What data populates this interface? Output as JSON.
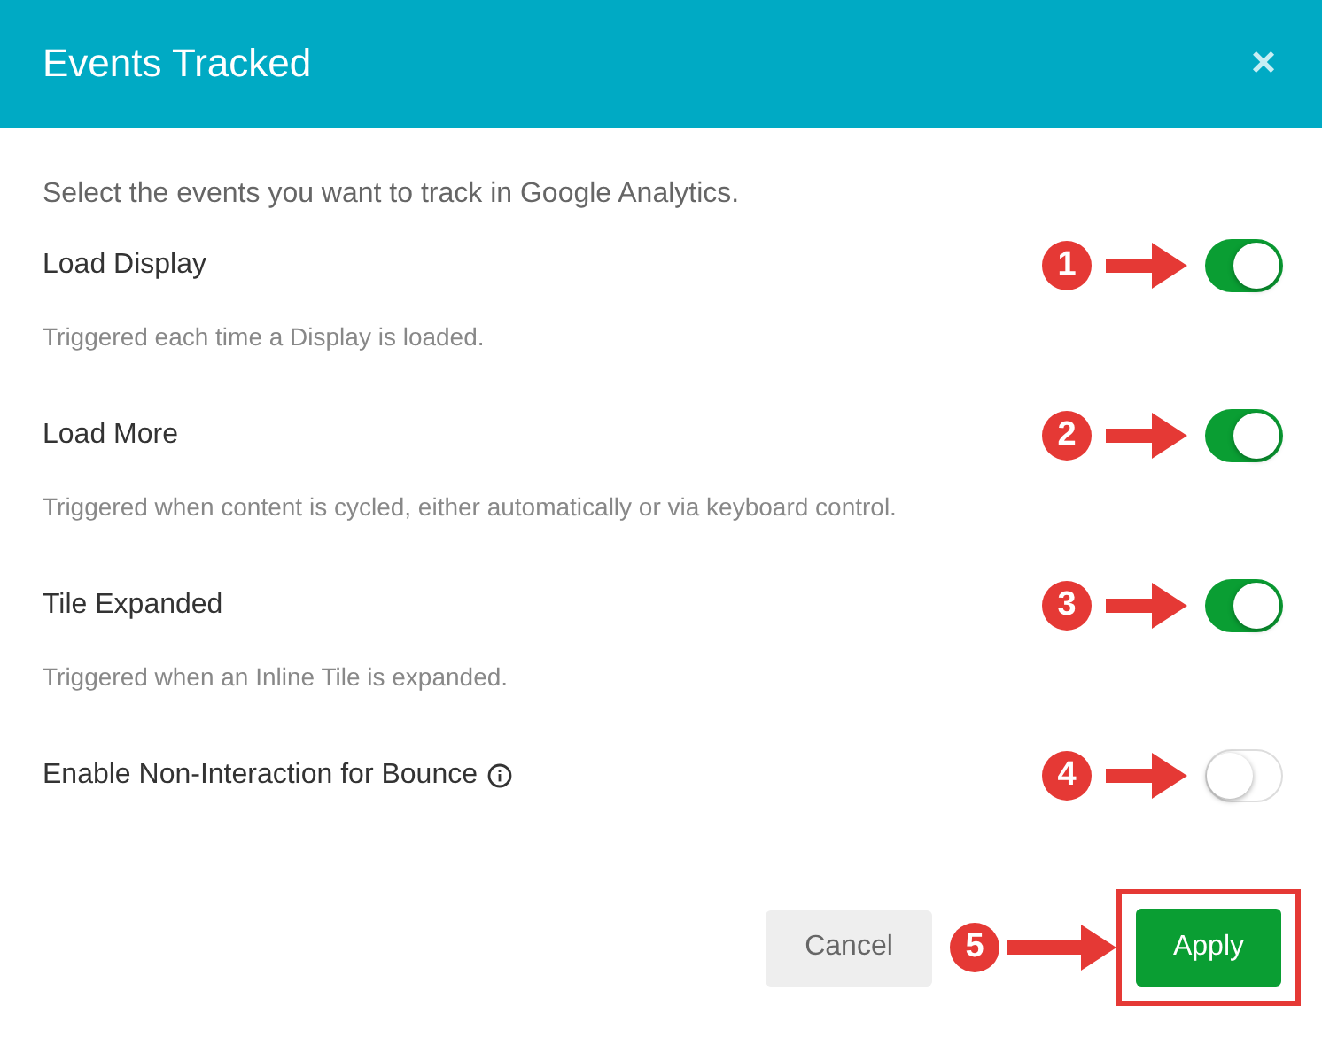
{
  "dialog": {
    "title": "Events Tracked",
    "close": "×",
    "intro": "Select the events you want to track in Google Analytics."
  },
  "events": [
    {
      "label": "Load Display",
      "description": "Triggered each time a Display is loaded.",
      "on": true,
      "info": false,
      "annotation": "1"
    },
    {
      "label": "Load More",
      "description": "Triggered when content is cycled, either automatically or via keyboard control.",
      "on": true,
      "info": false,
      "annotation": "2"
    },
    {
      "label": "Tile Expanded",
      "description": "Triggered when an Inline Tile is expanded.",
      "on": true,
      "info": false,
      "annotation": "3"
    },
    {
      "label": "Enable Non-Interaction for Bounce",
      "on": false,
      "info": true,
      "annotation": "4"
    }
  ],
  "buttons": {
    "cancel": "Cancel",
    "apply": "Apply",
    "apply_annotation": "5",
    "apply_highlighted": true
  }
}
